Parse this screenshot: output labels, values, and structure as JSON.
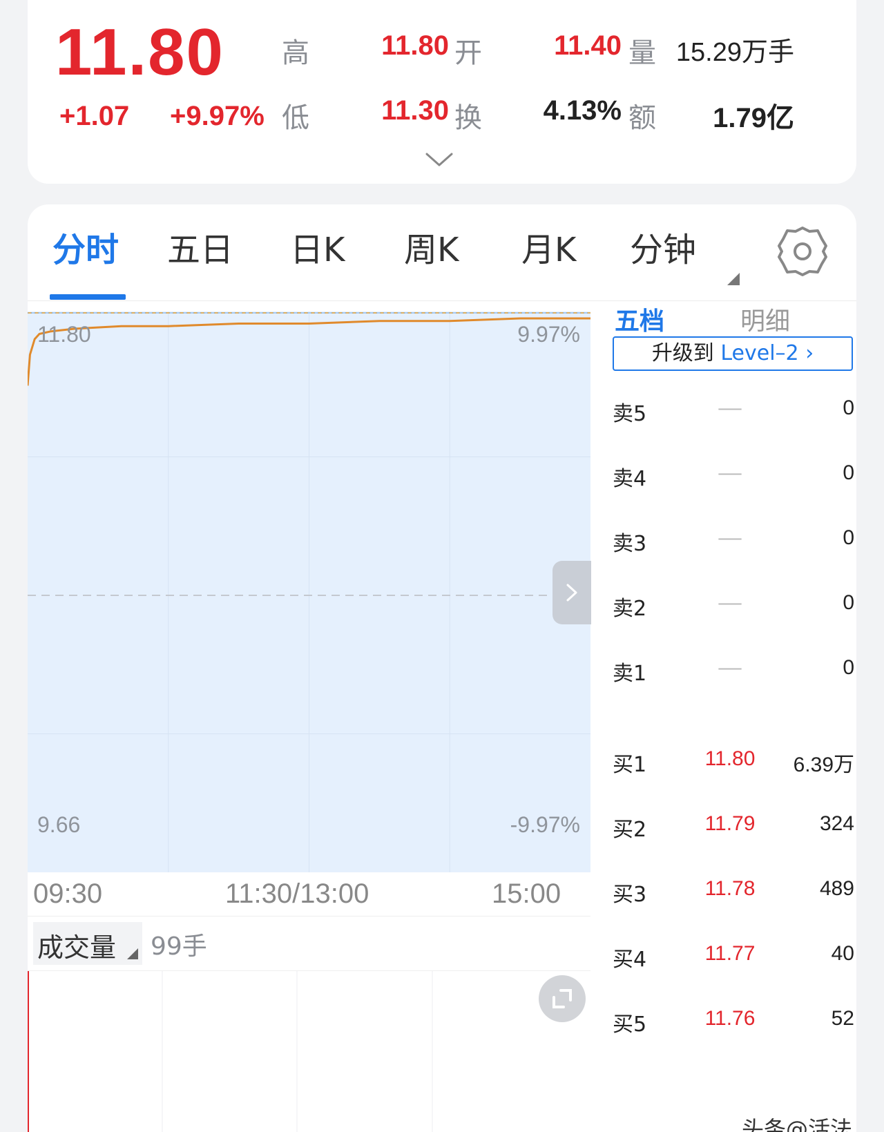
{
  "quote": {
    "price": "11.80",
    "change": "+1.07",
    "change_pct": "+9.97%",
    "high_label": "高",
    "high_value": "11.80",
    "open_label": "开",
    "open_value": "11.40",
    "volume_label": "量",
    "volume_value": "15.29万手",
    "low_label": "低",
    "low_value": "11.30",
    "turnover_label": "换",
    "turnover_value": "4.13%",
    "amount_label": "额",
    "amount_value": "1.79亿"
  },
  "tabs": [
    {
      "label": "分时",
      "active": true
    },
    {
      "label": "五日",
      "active": false
    },
    {
      "label": "日K",
      "active": false
    },
    {
      "label": "周K",
      "active": false
    },
    {
      "label": "月K",
      "active": false
    },
    {
      "label": "分钟",
      "active": false
    }
  ],
  "chart": {
    "y_top_price": "11.80",
    "y_top_pct": "9.97%",
    "y_bottom_price": "9.66",
    "y_bottom_pct": "-9.97%",
    "time_start": "09:30",
    "time_mid": "11:30/13:00",
    "time_end": "15:00",
    "line_color": "#e08a2c",
    "fill_color": "#e5f0fd",
    "accent_color": "#1f78e8",
    "up_color": "#e3262d"
  },
  "chart_data": {
    "type": "line",
    "x": [
      "09:30",
      "09:31",
      "09:33",
      "09:35",
      "09:40",
      "09:50",
      "10:10",
      "10:30",
      "11:00",
      "11:30",
      "13:30",
      "14:00",
      "14:30",
      "15:00"
    ],
    "series": [
      {
        "values": [
          11.54,
          11.66,
          11.72,
          11.74,
          11.75,
          11.76,
          11.77,
          11.77,
          11.78,
          11.78,
          11.79,
          11.79,
          11.8,
          11.8
        ]
      }
    ],
    "ylim": [
      9.66,
      11.8
    ],
    "grid": true
  },
  "volume": {
    "selector_label": "成交量",
    "value": "99手"
  },
  "orderbook": {
    "tab_active": "五档",
    "tab_inactive": "明细",
    "level2_prefix": "升级到",
    "level2_link": "Level–2",
    "sells": [
      {
        "label": "卖5",
        "price": "––",
        "vol": "0"
      },
      {
        "label": "卖4",
        "price": "––",
        "vol": "0"
      },
      {
        "label": "卖3",
        "price": "––",
        "vol": "0"
      },
      {
        "label": "卖2",
        "price": "––",
        "vol": "0"
      },
      {
        "label": "卖1",
        "price": "––",
        "vol": "0"
      }
    ],
    "buys": [
      {
        "label": "买1",
        "price": "11.80",
        "vol": "6.39万"
      },
      {
        "label": "买2",
        "price": "11.79",
        "vol": "324"
      },
      {
        "label": "买3",
        "price": "11.78",
        "vol": "489"
      },
      {
        "label": "买4",
        "price": "11.77",
        "vol": "40"
      },
      {
        "label": "买5",
        "price": "11.76",
        "vol": "52"
      }
    ]
  },
  "watermark": "头条@活法"
}
